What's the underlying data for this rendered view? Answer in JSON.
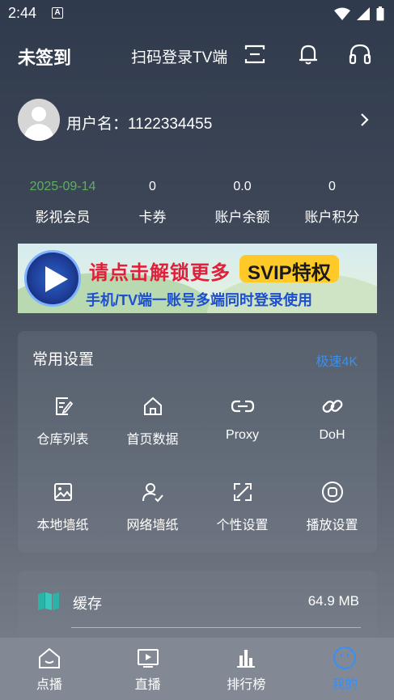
{
  "status_bar": {
    "time": "2:44"
  },
  "header": {
    "signin_status": "未签到",
    "scan_login": "扫码登录TV端"
  },
  "profile": {
    "username_label": "用户名：1122334455"
  },
  "stats": [
    {
      "value": "2025-09-14",
      "label": "影视会员"
    },
    {
      "value": "0",
      "label": "卡券"
    },
    {
      "value": "0.0",
      "label": "账户余额"
    },
    {
      "value": "0",
      "label": "账户积分"
    }
  ],
  "banner": {
    "line1": "请点击解锁更多",
    "badge": "SVIP特权",
    "line2": "手机/TV端一账号多端同时登录使用"
  },
  "settings": {
    "title": "常用设置",
    "speed_label": "极速4K",
    "items": [
      {
        "label": "仓库列表",
        "icon": "edit-note-icon"
      },
      {
        "label": "首页数据",
        "icon": "home-icon"
      },
      {
        "label": "Proxy",
        "icon": "link-icon"
      },
      {
        "label": "DoH",
        "icon": "chain-icon"
      },
      {
        "label": "本地墙纸",
        "icon": "image-icon"
      },
      {
        "label": "网络墙纸",
        "icon": "user-check-icon"
      },
      {
        "label": "个性设置",
        "icon": "expand-icon"
      },
      {
        "label": "播放设置",
        "icon": "record-icon"
      }
    ]
  },
  "cache": {
    "label": "缓存",
    "value": "64.9 MB"
  },
  "tabs": [
    {
      "label": "点播",
      "icon": "home-face-icon",
      "active": false
    },
    {
      "label": "直播",
      "icon": "play-screen-icon",
      "active": false
    },
    {
      "label": "排行榜",
      "icon": "bar-chart-icon",
      "active": false
    },
    {
      "label": "我的",
      "icon": "smile-icon",
      "active": true
    }
  ],
  "colors": {
    "accent": "#3c8ff0",
    "member_date": "#5fae5f",
    "banner_red": "#e0203a",
    "banner_blue": "#1d4fd0",
    "svip_gold": "#ffc928"
  }
}
